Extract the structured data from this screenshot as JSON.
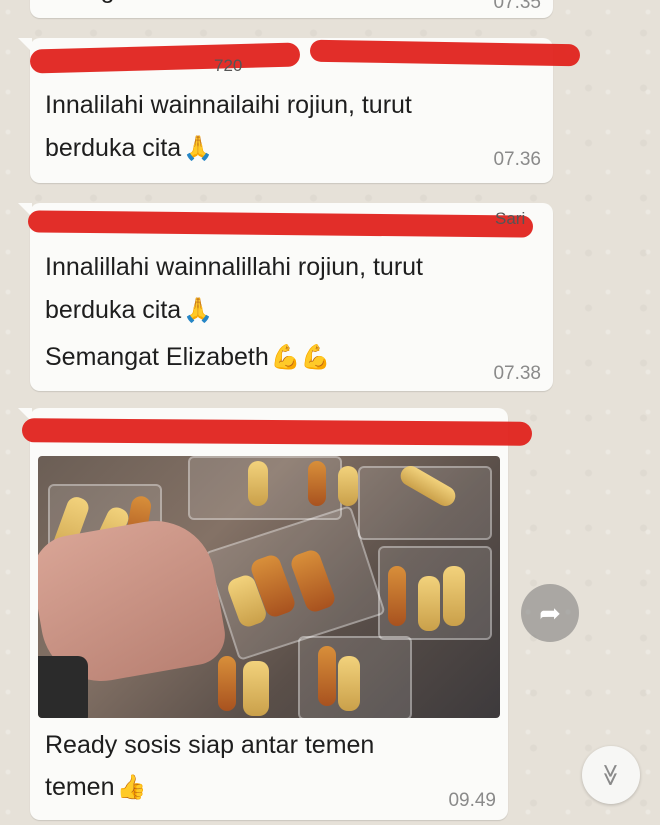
{
  "messages": [
    {
      "text_lines": [
        "strong"
      ],
      "time": "07.35"
    },
    {
      "sender_suffix": "720",
      "text_lines": [
        "Innalilahi wainnailaihi rojiun, turut",
        "berduka cita"
      ],
      "emoji": "🙏",
      "time": "07.36"
    },
    {
      "sender_suffix": "Sari",
      "text_lines": [
        "Innalillahi wainnalillahi rojiun, turut",
        "berduka cita",
        "Semangat Elizabeth"
      ],
      "emojis": [
        "🙏",
        "💪💪"
      ],
      "time": "07.38"
    },
    {
      "text_lines": [
        "Ready sosis siap antar temen",
        "temen"
      ],
      "emoji": "👍",
      "time": "09.49"
    }
  ],
  "icons": {
    "forward": "forward-arrow-icon",
    "scroll_down": "double-chevron-down-icon"
  },
  "glyphs": {
    "forward": "➦",
    "scroll_down": "≫"
  },
  "colors": {
    "chat_background": "#e6e1d8",
    "bubble": "#fbfbf9",
    "redaction": "#e0231e",
    "timestamp": "#8a8a8a"
  }
}
